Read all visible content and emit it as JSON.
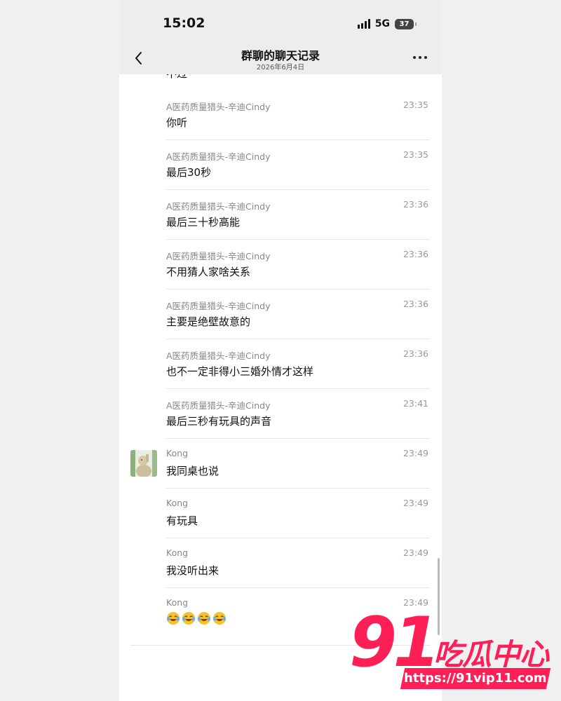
{
  "status_bar": {
    "time": "15:02",
    "network": "5G",
    "battery": "37"
  },
  "header": {
    "title": "群聊的聊天记录",
    "date": "2026年6月4日"
  },
  "partial_message_text": "不过",
  "messages": [
    {
      "name": "A医药质量猎头-辛迪Cindy",
      "time": "23:35",
      "text": "你听"
    },
    {
      "name": "A医药质量猎头-辛迪Cindy",
      "time": "23:35",
      "text": "最后30秒"
    },
    {
      "name": "A医药质量猎头-辛迪Cindy",
      "time": "23:36",
      "text": "最后三十秒高能"
    },
    {
      "name": "A医药质量猎头-辛迪Cindy",
      "time": "23:36",
      "text": "不用猜人家啥关系"
    },
    {
      "name": "A医药质量猎头-辛迪Cindy",
      "time": "23:36",
      "text": "主要是绝壁故意的"
    },
    {
      "name": "A医药质量猎头-辛迪Cindy",
      "time": "23:36",
      "text": "也不一定非得小三婚外情才这样"
    },
    {
      "name": "A医药质量猎头-辛迪Cindy",
      "time": "23:41",
      "text": "最后三秒有玩具的声音"
    },
    {
      "name": "Kong",
      "time": "23:49",
      "text": "我同桌也说"
    },
    {
      "name": "Kong",
      "time": "23:49",
      "text": "有玩具"
    },
    {
      "name": "Kong",
      "time": "23:49",
      "text": "我没听出来"
    },
    {
      "name": "Kong",
      "time": "23:49",
      "emoji": [
        "laugh-cry-emoji",
        "laugh-cry-emoji",
        "laugh-cry-emoji",
        "laugh-cry-emoji"
      ]
    }
  ],
  "watermark": {
    "logo": "91",
    "name": "吃瓜中心",
    "url": "https://91vip11.com",
    "color": "#ff1f57"
  }
}
